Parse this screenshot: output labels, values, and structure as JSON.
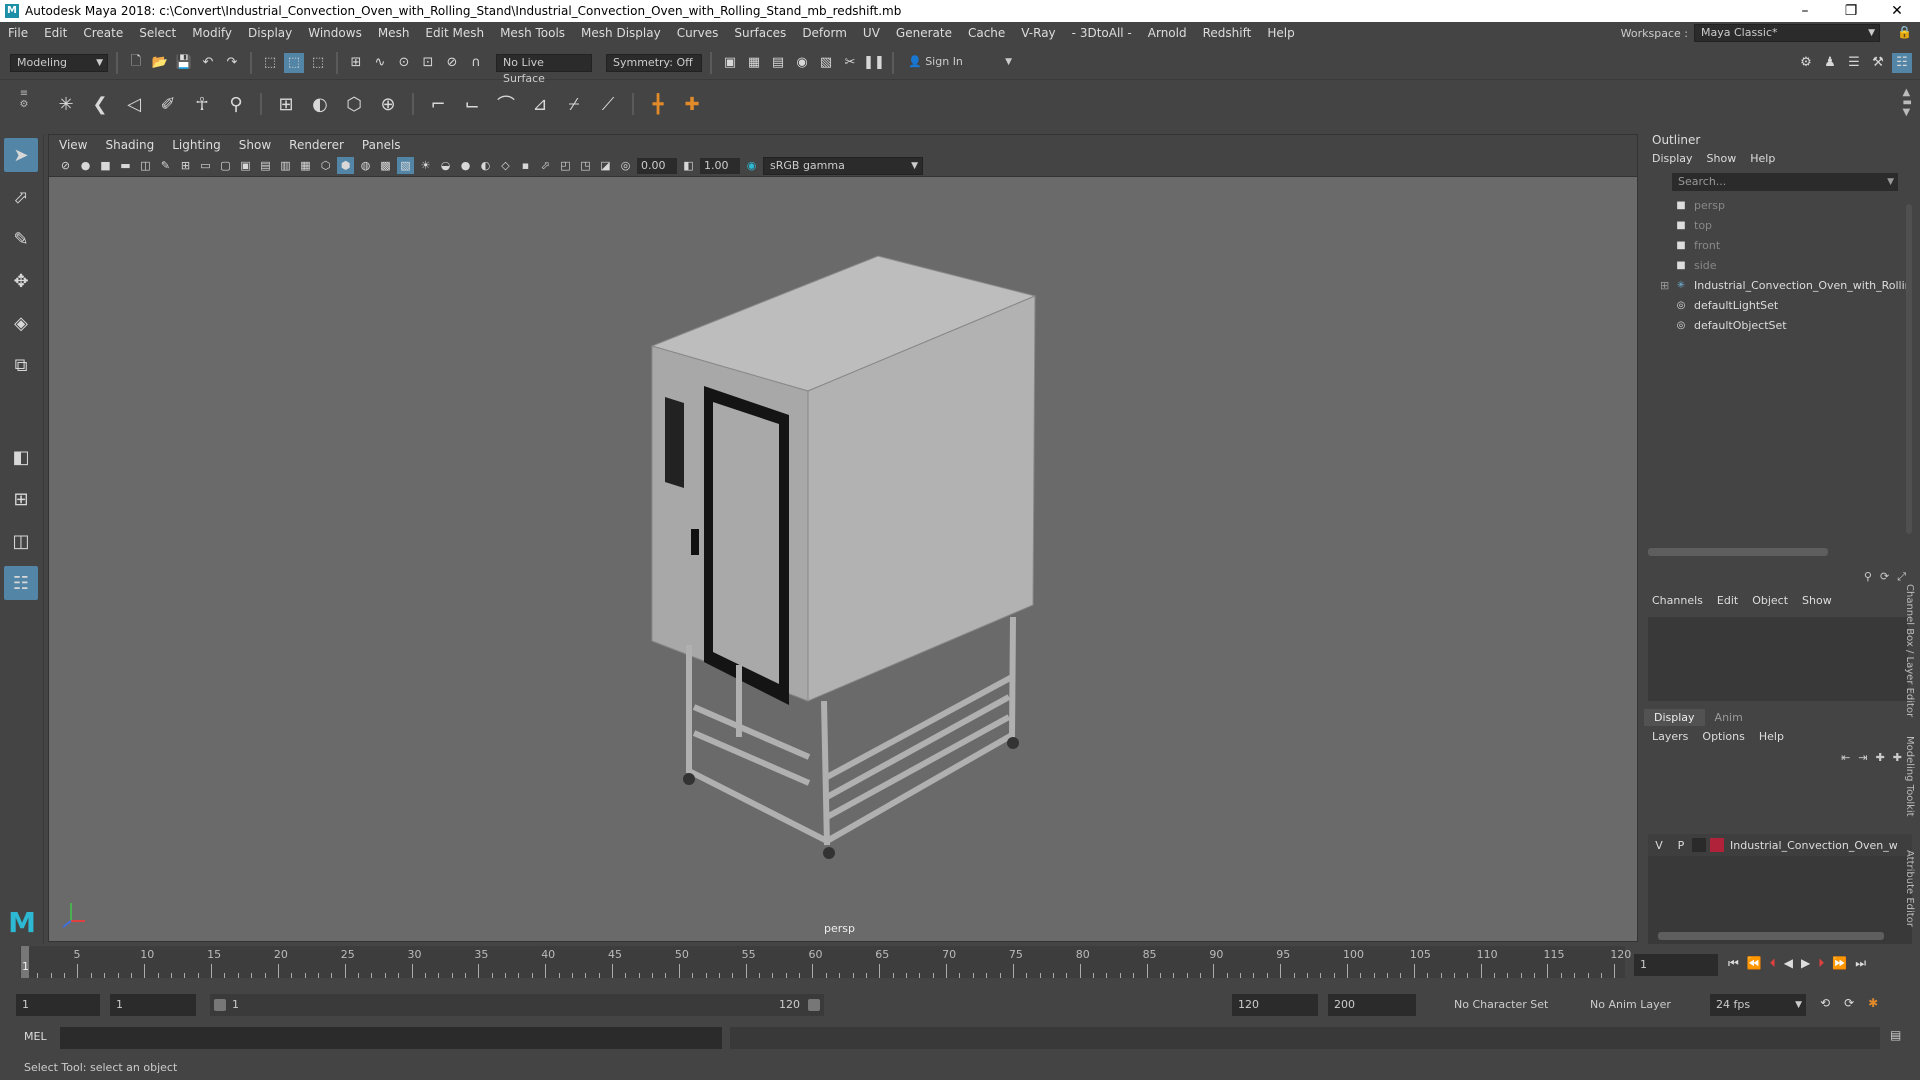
{
  "window": {
    "title": "Autodesk Maya 2018: c:\\Convert\\Industrial_Convection_Oven_with_Rolling_Stand\\Industrial_Convection_Oven_with_Rolling_Stand_mb_redshift.mb",
    "logo": "M",
    "min": "–",
    "max": "❐",
    "close": "✕"
  },
  "menu": [
    "File",
    "Edit",
    "Create",
    "Select",
    "Modify",
    "Display",
    "Windows",
    "Mesh",
    "Edit Mesh",
    "Mesh Tools",
    "Mesh Display",
    "Curves",
    "Surfaces",
    "Deform",
    "UV",
    "Generate",
    "Cache",
    "V-Ray",
    "- 3DtoAll -",
    "Arnold",
    "Redshift",
    "Help"
  ],
  "workspace": {
    "label": "Workspace :",
    "value": "Maya Classic*"
  },
  "statusline": {
    "mode": "Modeling",
    "live_surface": "No Live Surface",
    "symmetry": "Symmetry: Off",
    "sign_in": "Sign In"
  },
  "viewport": {
    "menu": [
      "View",
      "Shading",
      "Lighting",
      "Show",
      "Renderer",
      "Panels"
    ],
    "exposure": "0.00",
    "gamma": "1.00",
    "colorspace": "sRGB gamma",
    "camera_label": "persp"
  },
  "outliner": {
    "title": "Outliner",
    "menu": [
      "Display",
      "Show",
      "Help"
    ],
    "search_placeholder": "Search...",
    "items": [
      {
        "label": "persp",
        "icon": "camera-icon",
        "dim": true
      },
      {
        "label": "top",
        "icon": "camera-icon",
        "dim": true
      },
      {
        "label": "front",
        "icon": "camera-icon",
        "dim": true
      },
      {
        "label": "side",
        "icon": "camera-icon",
        "dim": true
      },
      {
        "label": "Industrial_Convection_Oven_with_Rollin",
        "icon": "transform-icon",
        "dim": false
      },
      {
        "label": "defaultLightSet",
        "icon": "set-icon",
        "dim": false
      },
      {
        "label": "defaultObjectSet",
        "icon": "set-icon",
        "dim": false
      }
    ]
  },
  "channelbox": {
    "menu": [
      "Channels",
      "Edit",
      "Object",
      "Show"
    ],
    "side_tabs": [
      "Channel Box / Layer Editor",
      "Modeling Toolkit",
      "Attribute Editor"
    ]
  },
  "layers": {
    "tabs": [
      "Display",
      "Anim"
    ],
    "menu": [
      "Layers",
      "Options",
      "Help"
    ],
    "row": {
      "v": "V",
      "p": "P",
      "name": "Industrial_Convection_Oven_w",
      "color": "#b0223a"
    }
  },
  "timeline": {
    "ticks": [
      "5",
      "10",
      "15",
      "20",
      "25",
      "30",
      "35",
      "40",
      "45",
      "50",
      "55",
      "60",
      "65",
      "70",
      "75",
      "80",
      "85",
      "90",
      "95",
      "100",
      "105",
      "110",
      "115",
      "120"
    ],
    "start_mark": "1",
    "current_frame": "1"
  },
  "range": {
    "start": "1",
    "anim_start": "1",
    "slider_start": "1",
    "slider_end": "120",
    "end": "120",
    "anim_end": "200",
    "character_set": "No Character Set",
    "anim_layer": "No Anim Layer",
    "fps": "24 fps"
  },
  "cmd": {
    "label": "MEL"
  },
  "help_line": "Select Tool: select an object"
}
